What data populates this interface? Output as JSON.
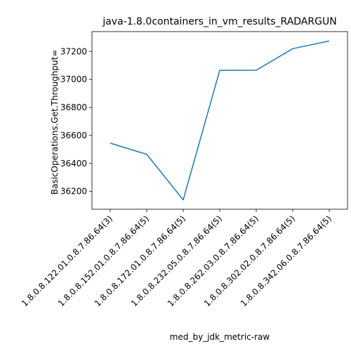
{
  "chart_data": {
    "type": "line",
    "title": "java-1.8.0containers_in_vm_results_RADARGUN",
    "xlabel": "med_by_jdk_metric-raw",
    "ylabel": "BasicOperations.Get.Throughput=",
    "categories": [
      "1.8.0.8.122.01.0.8.7.86.64(3)",
      "1.8.0.8.152.01.0.8.7.86.64(5)",
      "1.8.0.8.172.01.0.8.7.86.64(5)",
      "1.8.0.8.232.05.0.8.7.86.64(5)",
      "1.8.0.8.262.03.0.8.7.86.64(5)",
      "1.8.0.8.302.02.0.8.7.86.64(5)",
      "1.8.0.8.342.06.0.8.7.86.64(5)"
    ],
    "series": [
      {
        "values": [
          36545,
          36465,
          36140,
          37065,
          37066,
          37220,
          37275
        ],
        "color": "#1f77b4"
      }
    ],
    "yticks": [
      36200,
      36400,
      36600,
      36800,
      37000,
      37200
    ],
    "ylim": [
      36073,
      37342
    ],
    "grid": false,
    "legend": "none"
  }
}
